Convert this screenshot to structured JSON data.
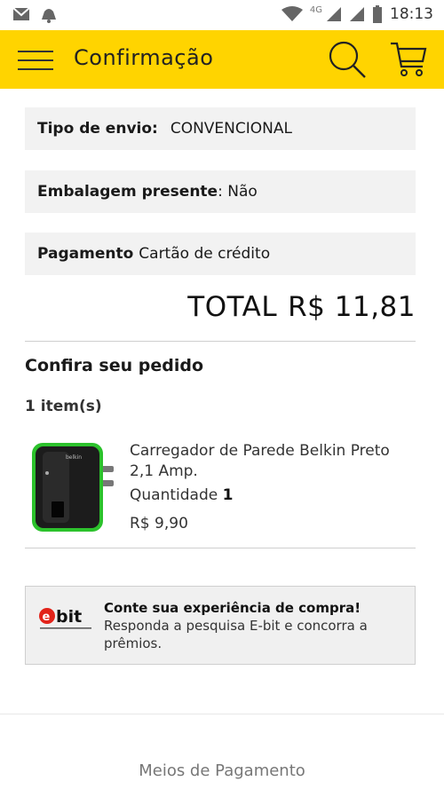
{
  "status_bar": {
    "network": "4G",
    "time": "18:13",
    "icons": [
      "gmail-icon",
      "notification-icon",
      "wifi-icon",
      "signal-icon",
      "signal-icon",
      "battery-icon"
    ]
  },
  "header": {
    "title": "Confirmação",
    "accent_color": "#ffd400",
    "icons": [
      "menu-icon",
      "search-icon",
      "cart-icon"
    ]
  },
  "order": {
    "shipping_label": "Tipo de envio:",
    "shipping_value": "CONVENCIONAL",
    "gift_label": "Embalagem presente",
    "gift_value": ": Não",
    "payment_label": "Pagamento",
    "payment_value": "Cartão de crédito",
    "total_label": "TOTAL",
    "total_value": "R$ 11,81"
  },
  "review": {
    "title": "Confira seu pedido",
    "items_count": "1 item(s)",
    "items": [
      {
        "name": "Carregador de Parede Belkin Preto 2,1 Amp.",
        "qty_label": "Quantidade",
        "qty_value": "1",
        "price": "R$ 9,90"
      }
    ]
  },
  "ebit": {
    "logo_text": "ebit",
    "logo_tagline": "A certificação dos consumidores",
    "title": "Conte sua experiência de compra!",
    "text": "Responda a pesquisa E-bit e concorra a prêmios."
  },
  "footer": {
    "link": "Meios de Pagamento"
  }
}
